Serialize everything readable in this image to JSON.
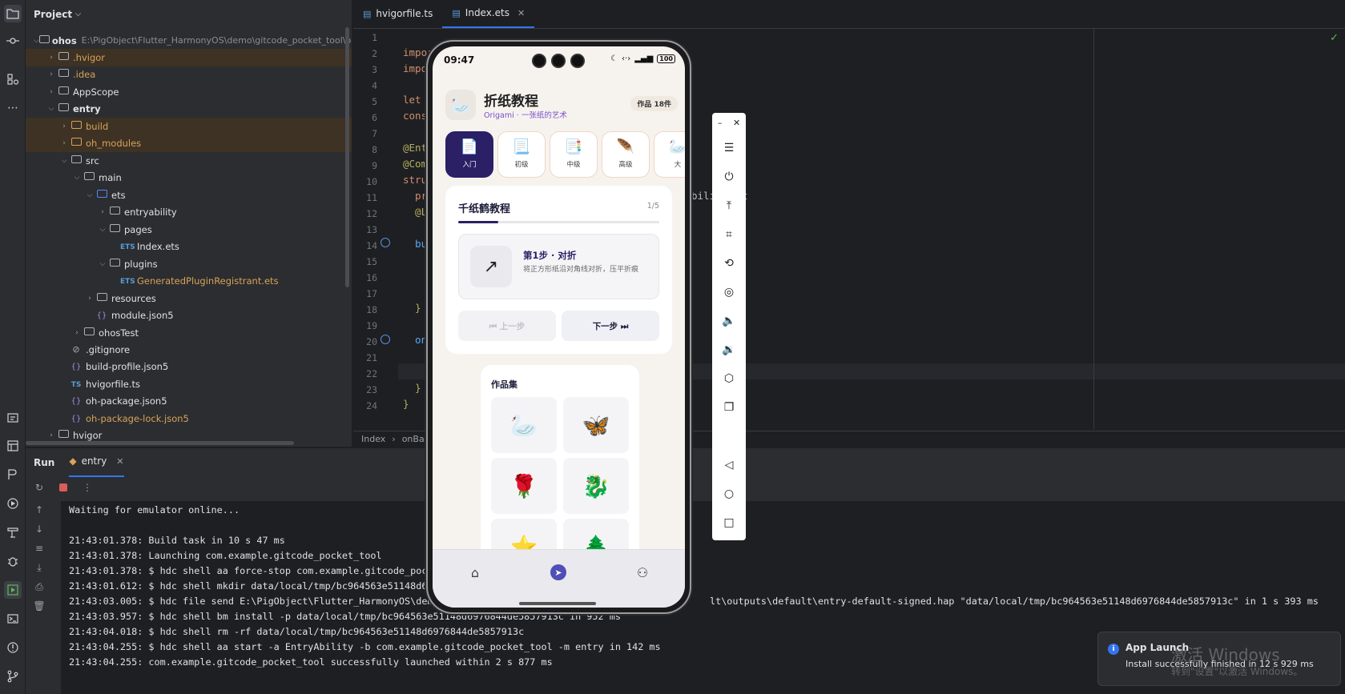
{
  "project": {
    "title": "Project",
    "tree": [
      {
        "label": "ohos",
        "path": "E:\\PigObject\\Flutter_HarmonyOS\\demo\\gitcode_pocket_tool\\ohos"
      },
      {
        "label": ".hvigor"
      },
      {
        "label": ".idea"
      },
      {
        "label": "AppScope"
      },
      {
        "label": "entry"
      },
      {
        "label": "build"
      },
      {
        "label": "oh_modules"
      },
      {
        "label": "src"
      },
      {
        "label": "main"
      },
      {
        "label": "ets"
      },
      {
        "label": "entryability"
      },
      {
        "label": "pages"
      },
      {
        "label": "Index.ets"
      },
      {
        "label": "plugins"
      },
      {
        "label": "GeneratedPluginRegistrant.ets"
      },
      {
        "label": "resources"
      },
      {
        "label": "module.json5"
      },
      {
        "label": "ohosTest"
      },
      {
        "label": ".gitignore"
      },
      {
        "label": "build-profile.json5"
      },
      {
        "label": "hvigorfile.ts"
      },
      {
        "label": "oh-package.json5"
      },
      {
        "label": "oh-package-lock.json5"
      },
      {
        "label": "hvigor"
      }
    ]
  },
  "editor": {
    "tabs": [
      {
        "label": "hvigorfile.ts"
      },
      {
        "label": "Index.ets"
      }
    ],
    "lines": {
      "l2": "impor",
      "l3": "impo",
      "l5": "let ",
      "l6": "cons",
      "l8": "@Ent",
      "l9": "@Com",
      "l10": "stru",
      "l11": "  pr",
      "l11_tail": "bili",
      "l11_tail2": "ext",
      "l12": "  @L",
      "l14": "  bu",
      "l18": "  }",
      "l20": "  on",
      "l23": "  }",
      "l24": "}"
    },
    "breadcrumb": [
      "Index",
      "onBac"
    ]
  },
  "run": {
    "title": "Run",
    "tab": "entry",
    "lines": [
      "Waiting for emulator online...",
      "",
      "21:43:01.378: Build task in 10 s 47 ms",
      "21:43:01.378: Launching com.example.gitcode_pocket_tool",
      "21:43:01.378: $ hdc shell aa force-stop com.example.gitcode_pock",
      "21:43:01.612: $ hdc shell mkdir data/local/tmp/bc964563e51148d69",
      "21:43:03.005: $ hdc file send E:\\PigObject\\Flutter_HarmonyOS\\demo",
      "21:43:03.957: $ hdc shell bm install -p data/local/tmp/bc964563e51148d6976844de5857913c in 952 ms",
      "21:43:04.018: $ hdc shell rm -rf data/local/tmp/bc964563e51148d6976844de5857913c",
      "21:43:04.255: $ hdc shell aa start -a EntryAbility -b com.example.gitcode_pocket_tool -m entry in 142 ms",
      "21:43:04.255: com.example.gitcode_pocket_tool successfully launched within 2 s 877 ms"
    ],
    "line7_tail": "lt\\outputs\\default\\entry-default-signed.hap \"data/local/tmp/bc964563e51148d6976844de5857913c\" in 1 s 393 ms"
  },
  "phone": {
    "time": "09:47",
    "battery": "100",
    "app_title": "折纸教程",
    "app_subtitle": "Origami · 一张纸的艺术",
    "works_badge": "作品 18件",
    "levels": [
      {
        "label": "入门",
        "icon": "📄"
      },
      {
        "label": "初级",
        "icon": "📃"
      },
      {
        "label": "中级",
        "icon": "📑"
      },
      {
        "label": "高级",
        "icon": "🪶"
      },
      {
        "label": "大",
        "icon": "🦢"
      }
    ],
    "tutorial": {
      "title": "千纸鹤教程",
      "count": "1/5",
      "progress": 0.2,
      "step_title": "第1步 · 对折",
      "step_desc": "将正方形纸沿对角线对折，压平折痕",
      "prev": "⏮ 上一步",
      "next": "下一步 ⏭"
    },
    "gallery": {
      "title": "作品集",
      "items": [
        "🦢",
        "🦋",
        "🌹",
        "🐉",
        "⭐",
        "🌲"
      ]
    }
  },
  "notification": {
    "title": "App Launch",
    "body": "Install successfully finished in 12 s 929 ms"
  },
  "watermark": {
    "line1": "激活 Windows",
    "line2": "转到\"设置\"以激活 Windows。"
  }
}
